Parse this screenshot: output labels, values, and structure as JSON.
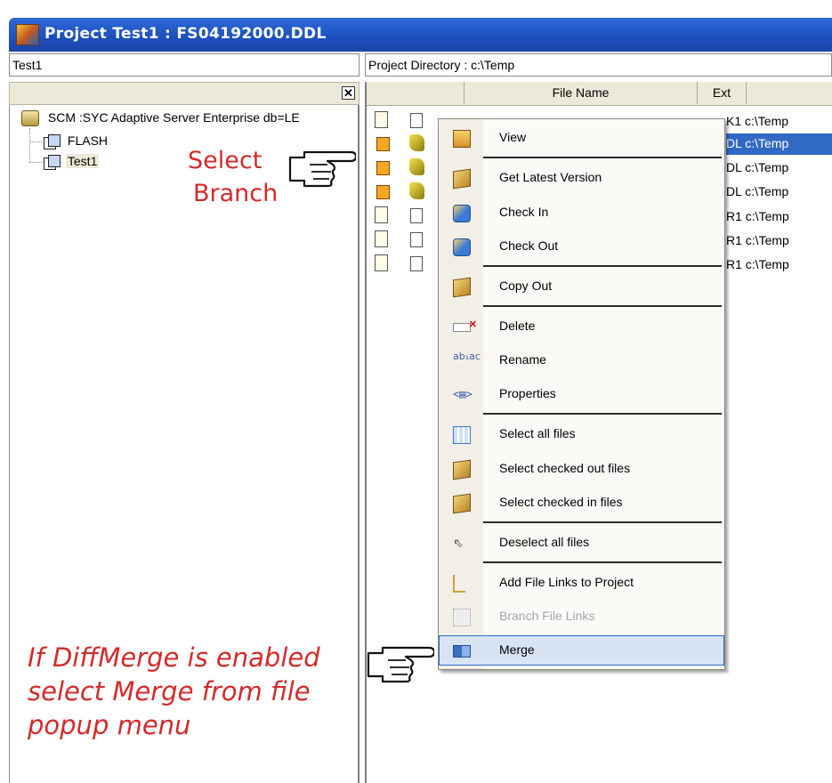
{
  "window": {
    "title": "Project  Test1 : FS04192000.DDL"
  },
  "left_pane": {
    "path_value": "Test1",
    "close_glyph": "✕",
    "tree": {
      "root_label": "SCM :SYC Adaptive Server Enterprise db=LE",
      "children": [
        {
          "label": "FLASH"
        },
        {
          "label": "Test1"
        }
      ]
    }
  },
  "right_pane": {
    "path_value": "Project Directory : c:\\Temp",
    "columns": {
      "file_name": "File Name",
      "ext": "Ext"
    },
    "rows": [
      {
        "tail": "K1  c:\\Temp"
      },
      {
        "tail": "DL  c:\\Temp"
      },
      {
        "tail": "DL  c:\\Temp"
      },
      {
        "tail": "DL  c:\\Temp"
      },
      {
        "tail": "R1  c:\\Temp"
      },
      {
        "tail": "R1  c:\\Temp"
      },
      {
        "tail": "R1  c:\\Temp"
      }
    ]
  },
  "context_menu": {
    "items": {
      "view": "View",
      "get_latest": "Get Latest Version",
      "check_in": "Check In",
      "check_out": "Check Out",
      "copy_out": "Copy Out",
      "delete": "Delete",
      "rename": "Rename",
      "properties": "Properties",
      "select_all": "Select all files",
      "select_checked_out": "Select checked out files",
      "select_checked_in": "Select checked in files",
      "deselect_all": "Deselect all files",
      "add_file_links": "Add File Links to Project",
      "branch_file_links": "Branch File Links",
      "merge": "Merge"
    },
    "icons": {
      "rename": "ab₁ac",
      "properties": "<▤>",
      "deselect": "⇖"
    }
  },
  "annotations": {
    "select_branch_line1": "Select",
    "select_branch_line2": "Branch",
    "diffmerge_line1": "If DiffMerge is enabled",
    "diffmerge_line2": "select Merge from file",
    "diffmerge_line3": "popup menu",
    "color": "#d42a2a"
  }
}
